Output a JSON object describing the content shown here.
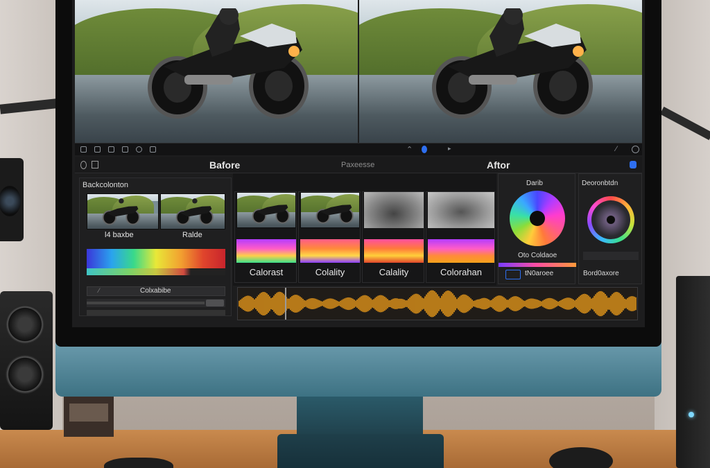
{
  "editor": {
    "compare_bar": {
      "before_label": "Bafore",
      "compare_label": "Paxeesse",
      "after_label": "Aftor"
    },
    "panel_background": {
      "title": "Backcolonton",
      "thumb_left_label": "l4 baxbe",
      "thumb_right_label": "Ralde",
      "colorable_label": "Colxabibe"
    },
    "filmstrip": {
      "items": [
        {
          "label": "Calorast"
        },
        {
          "label": "Colality"
        },
        {
          "label": "Calality"
        },
        {
          "label": "Colorahan"
        }
      ]
    },
    "wheel_panel": {
      "title": "Darib",
      "label": "Oto Coldaoe",
      "button_label": "tN0aroee"
    },
    "wheel2_panel": {
      "title": "Deoronbtdn",
      "label": "Bord0axore"
    }
  },
  "colors": {
    "accent_blue": "#2e6ff0",
    "waveform_orange": "#f6a21a",
    "bezel": "#0c0c0c",
    "monitor_chin": "#4f8596"
  },
  "icons": {
    "toolbar_left": [
      "monitor-icon",
      "layout-icon",
      "square-icon",
      "grid-icon",
      "settings-icon",
      "image-icon"
    ],
    "toolbar_right": [
      "pen-icon",
      "record-icon",
      "play-icon"
    ],
    "toolbar_far": [
      "pen-icon",
      "gear-icon"
    ]
  }
}
